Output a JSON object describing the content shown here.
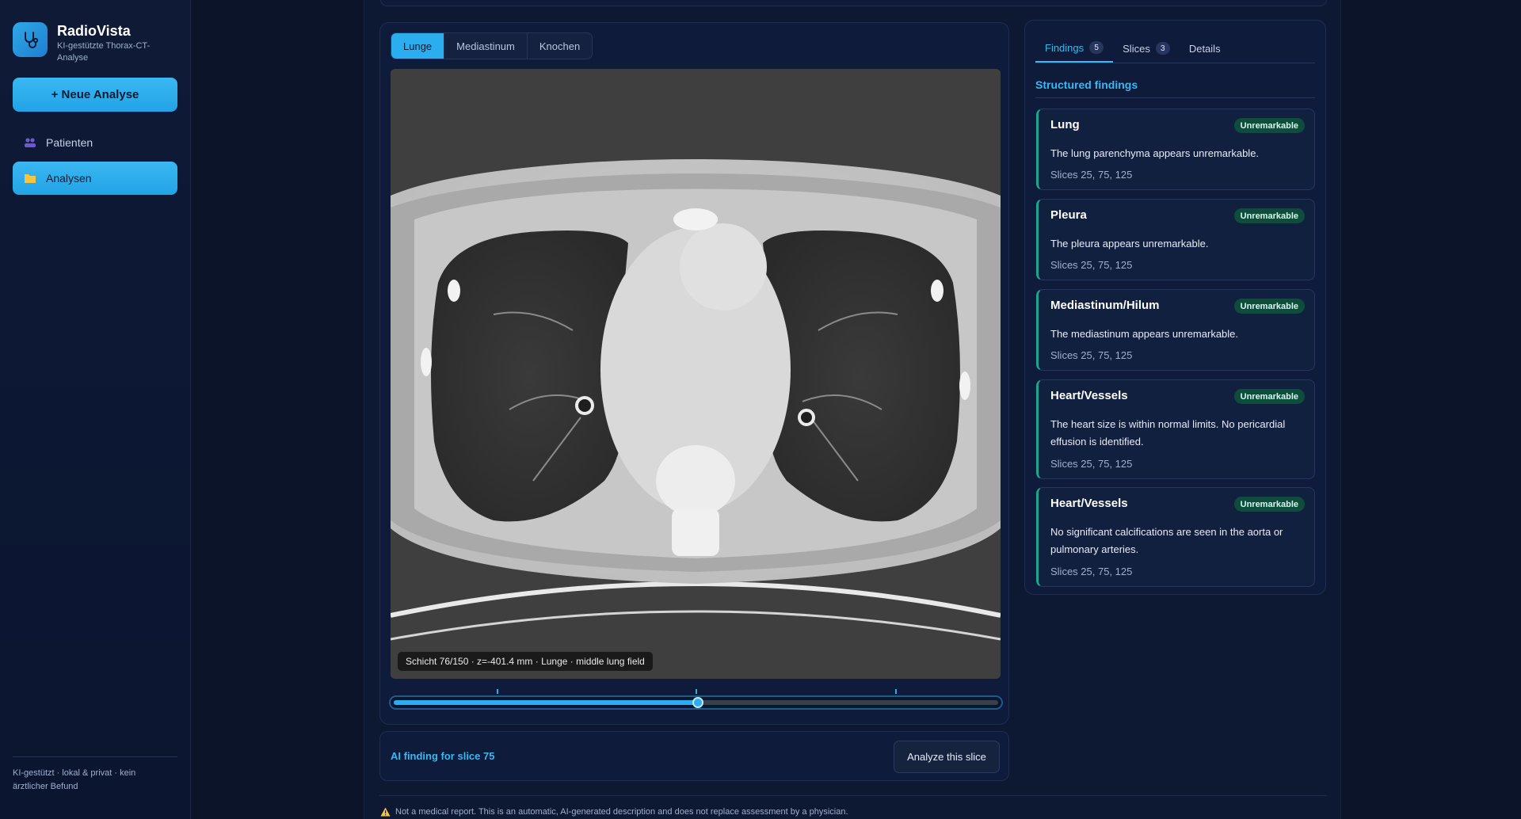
{
  "app": {
    "name": "RadioVista",
    "subtitle": "KI-gestützte Thorax-CT-Analyse"
  },
  "sidebar": {
    "new_analysis_label": "+ Neue Analyse",
    "items": [
      {
        "label": "Patienten",
        "icon": "users-icon",
        "active": false
      },
      {
        "label": "Analysen",
        "icon": "folder-icon",
        "active": true
      }
    ],
    "footer": "KI-gestützt · lokal & privat · kein ärztlicher Befund"
  },
  "viewer": {
    "window_tabs": [
      {
        "label": "Lunge",
        "active": true
      },
      {
        "label": "Mediastinum",
        "active": false
      },
      {
        "label": "Knochen",
        "active": false
      }
    ],
    "slice_caption": "Schicht 76/150 · z=-401.4 mm · Lunge · middle lung field",
    "slider": {
      "value": 76,
      "min": 1,
      "max": 150,
      "markers": [
        25,
        75,
        125
      ]
    }
  },
  "ai_finding": {
    "label": "AI finding for slice 75",
    "button_label": "Analyze this slice"
  },
  "disclaimer": "Not a medical report. This is an automatic, AI-generated description and does not replace assessment by a physician.",
  "findings_panel": {
    "tabs": [
      {
        "label": "Findings",
        "count": "5",
        "active": true
      },
      {
        "label": "Slices",
        "count": "3",
        "active": false
      },
      {
        "label": "Details",
        "count": null,
        "active": false
      }
    ],
    "section_title": "Structured findings",
    "items": [
      {
        "title": "Lung",
        "status": "Unremarkable",
        "description": "The lung parenchyma appears unremarkable.",
        "slices": "Slices 25, 75, 125"
      },
      {
        "title": "Pleura",
        "status": "Unremarkable",
        "description": "The pleura appears unremarkable.",
        "slices": "Slices 25, 75, 125"
      },
      {
        "title": "Mediastinum/Hilum",
        "status": "Unremarkable",
        "description": "The mediastinum appears unremarkable.",
        "slices": "Slices 25, 75, 125"
      },
      {
        "title": "Heart/Vessels",
        "status": "Unremarkable",
        "description": "The heart size is within normal limits. No pericardial effusion is identified.",
        "slices": "Slices 25, 75, 125"
      },
      {
        "title": "Heart/Vessels",
        "status": "Unremarkable",
        "description": "No significant calcifications are seen in the aorta or pulmonary arteries.",
        "slices": "Slices 25, 75, 125"
      }
    ]
  },
  "colors": {
    "accent": "#2aaef0",
    "background": "#0b1428",
    "status_ok": "#0e4d3c"
  }
}
